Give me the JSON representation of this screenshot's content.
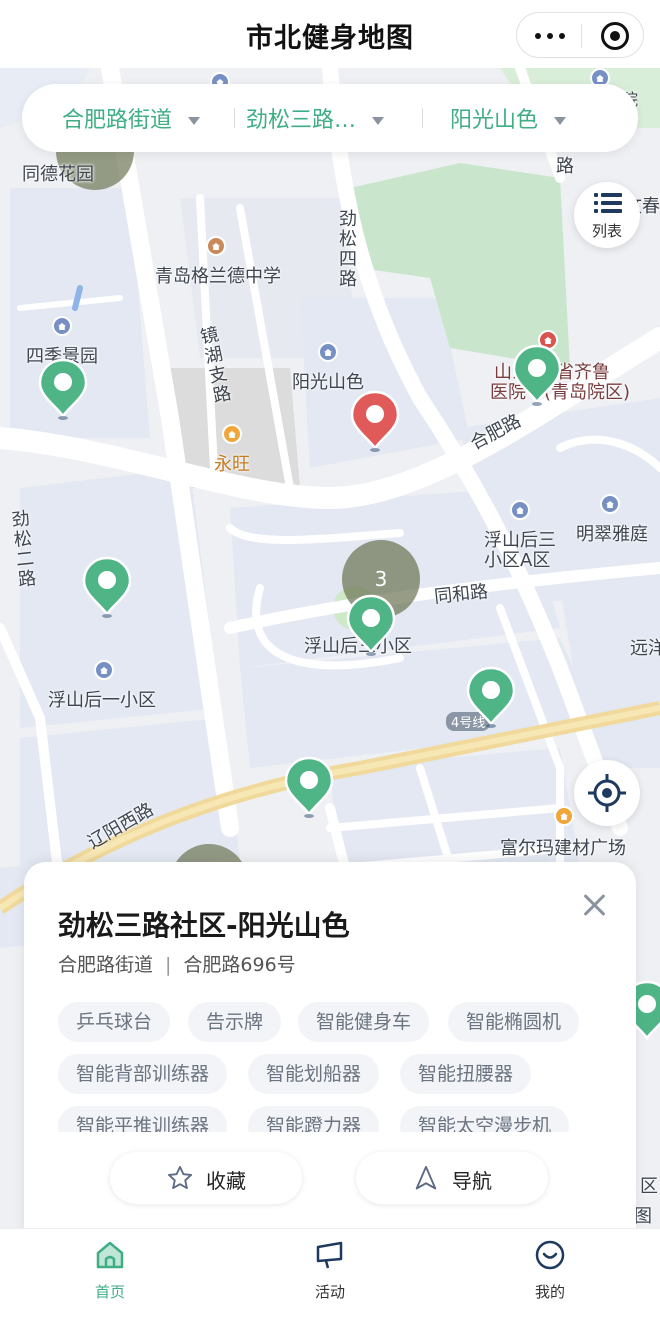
{
  "app": {
    "title": "市北健身地图"
  },
  "filters": [
    {
      "label": "合肥路街道"
    },
    {
      "label": "劲松三路…"
    },
    {
      "label": "阳光山色"
    }
  ],
  "list_button": {
    "label": "列表"
  },
  "map": {
    "labels": {
      "tongde": "同德花园",
      "qingdao_school": "青岛格兰德中学",
      "jinsong4": "劲松四路",
      "jinghu": "镜湖支路",
      "siji": "四季景园",
      "yangguang": "阳光山色",
      "hospital": "山东省齐鲁医院(青岛院区)",
      "hospital_l1": "山东",
      "hospital_l2": "省齐鲁",
      "hospital_l3": "医院",
      "hospital_l4": "(青岛院区)",
      "hefei_road": "合肥路",
      "yongwang": "永旺",
      "jinsong2": "劲松二路",
      "fushan_a": "浮山后三小区A区",
      "fushan_a1": "浮山后三",
      "fushan_a2": "小区A区",
      "mingcui": "明翠雅庭",
      "tonghe": "同和路",
      "fushan3": "浮山后三小区",
      "fushan1": "浮山后一小区",
      "yuanyang": "远洋",
      "line4": "4号线",
      "liaoyang": "辽阳西路",
      "fuerma": "富尔玛建材广场",
      "top_right": "院",
      "right_edge": "文春",
      "edge_road": "路",
      "small_edge": "区",
      "small_edge2": "图"
    },
    "cluster_count": "3"
  },
  "card": {
    "title": "劲松三路社区-阳光山色",
    "street": "合肥路街道",
    "separator": "|",
    "address": "合肥路696号",
    "tags": [
      "乒乓球台",
      "告示牌",
      "智能健身车",
      "智能椭圆机",
      "智能背部训练器",
      "智能划船器",
      "智能扭腰器",
      "智能平推训练器",
      "智能蹬力器",
      "智能太空漫步机"
    ],
    "favorite_label": "收藏",
    "navigate_label": "导航"
  },
  "tabs": [
    {
      "label": "首页",
      "active": true
    },
    {
      "label": "活动",
      "active": false
    },
    {
      "label": "我的",
      "active": false
    }
  ],
  "colors": {
    "accent": "#3fae85",
    "pin_green": "#4fb587",
    "pin_red": "#e05a5a"
  }
}
